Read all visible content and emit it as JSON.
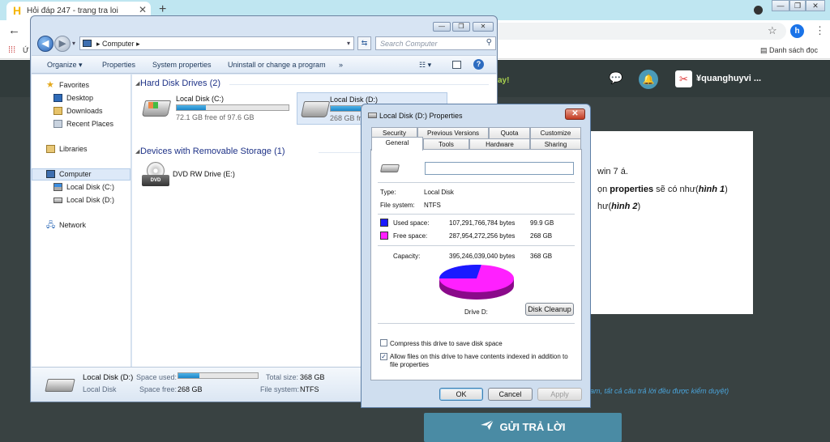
{
  "browser": {
    "tab_title": "Hỏi đáp 247 - trang tra loi",
    "tab_favicon": "H",
    "close_glyph": "✕",
    "newtab_glyph": "+",
    "back_glyph": "←",
    "bookmark_truncated": "Ứ",
    "reading_list": "Danh sách đọc",
    "avatar_letter": "h",
    "window_controls": [
      "—",
      "❐",
      "✕"
    ]
  },
  "site": {
    "promo_text": "ay!",
    "username": "quanghuyvi ...",
    "body_lines": [
      {
        "plain": "win 7 á."
      },
      {
        "pre": "ọn ",
        "bold": "properties",
        "mid": " sẽ có như(",
        "ital": "hình 1",
        "post": ")"
      },
      {
        "pre": "hư(",
        "ital": "hình 2",
        "post": ")"
      }
    ],
    "note": "am, tất cả câu trả lời đều được kiểm duyệt",
    "submit_label": "GỬI TRẢ LỜI"
  },
  "explorer": {
    "address": [
      "Computer",
      "▸"
    ],
    "search_placeholder": "Search Computer",
    "commands": [
      "Organize ▾",
      "Properties",
      "System properties",
      "Uninstall or change a program",
      "»"
    ],
    "nav": {
      "favorites": "Favorites",
      "desktop": "Desktop",
      "downloads": "Downloads",
      "recent": "Recent Places",
      "libraries": "Libraries",
      "computer": "Computer",
      "local_c": "Local Disk (C:)",
      "local_d": "Local Disk (D:)",
      "network": "Network"
    },
    "groups": {
      "hdd": "Hard Disk Drives (2)",
      "removable": "Devices with Removable Storage (1)"
    },
    "drives": [
      {
        "name": "Local Disk (C:)",
        "free": "72.1 GB free of 97.6 GB",
        "used_fraction": 0.26
      },
      {
        "name": "Local Disk (D:)",
        "free": "268 GB free of 368 GB",
        "used_fraction": 0.27
      }
    ],
    "dvd": {
      "name": "DVD RW Drive (E:)",
      "badge": "DVD"
    },
    "details": {
      "name": "Local Disk (D:)",
      "type": "Local Disk",
      "space_used_label": "Space used:",
      "space_free_label": "Space free:",
      "space_free": "268 GB",
      "total_label": "Total size:",
      "total": "368 GB",
      "fs_label": "File system:",
      "fs": "NTFS",
      "used_fraction": 0.27
    }
  },
  "dialog": {
    "title": "Local Disk (D:) Properties",
    "close_glyph": "✕",
    "tabs_row1": [
      "Security",
      "Previous Versions",
      "Quota",
      "Customize"
    ],
    "tabs_row2": [
      "General",
      "Tools",
      "Hardware",
      "Sharing"
    ],
    "type_label": "Type:",
    "type_value": "Local Disk",
    "fs_label": "File system:",
    "fs_value": "NTFS",
    "used_label": "Used space:",
    "used_bytes": "107,291,766,784 bytes",
    "used_gb": "99.9 GB",
    "free_label": "Free space:",
    "free_bytes": "287,954,272,256 bytes",
    "free_gb": "268 GB",
    "cap_label": "Capacity:",
    "cap_bytes": "395,246,039,040 bytes",
    "cap_gb": "368 GB",
    "drive_label": "Drive D:",
    "cleanup_label": "Disk Cleanup",
    "compress_label": "Compress this drive to save disk space",
    "index_label": "Allow files on this drive to have contents indexed in addition to",
    "index_label2": "file properties",
    "ok_label": "OK",
    "cancel_label": "Cancel",
    "apply_label": "Apply",
    "used_fraction": 0.27,
    "colors": {
      "used": "#1a1aff",
      "free": "#ff20ff"
    }
  }
}
